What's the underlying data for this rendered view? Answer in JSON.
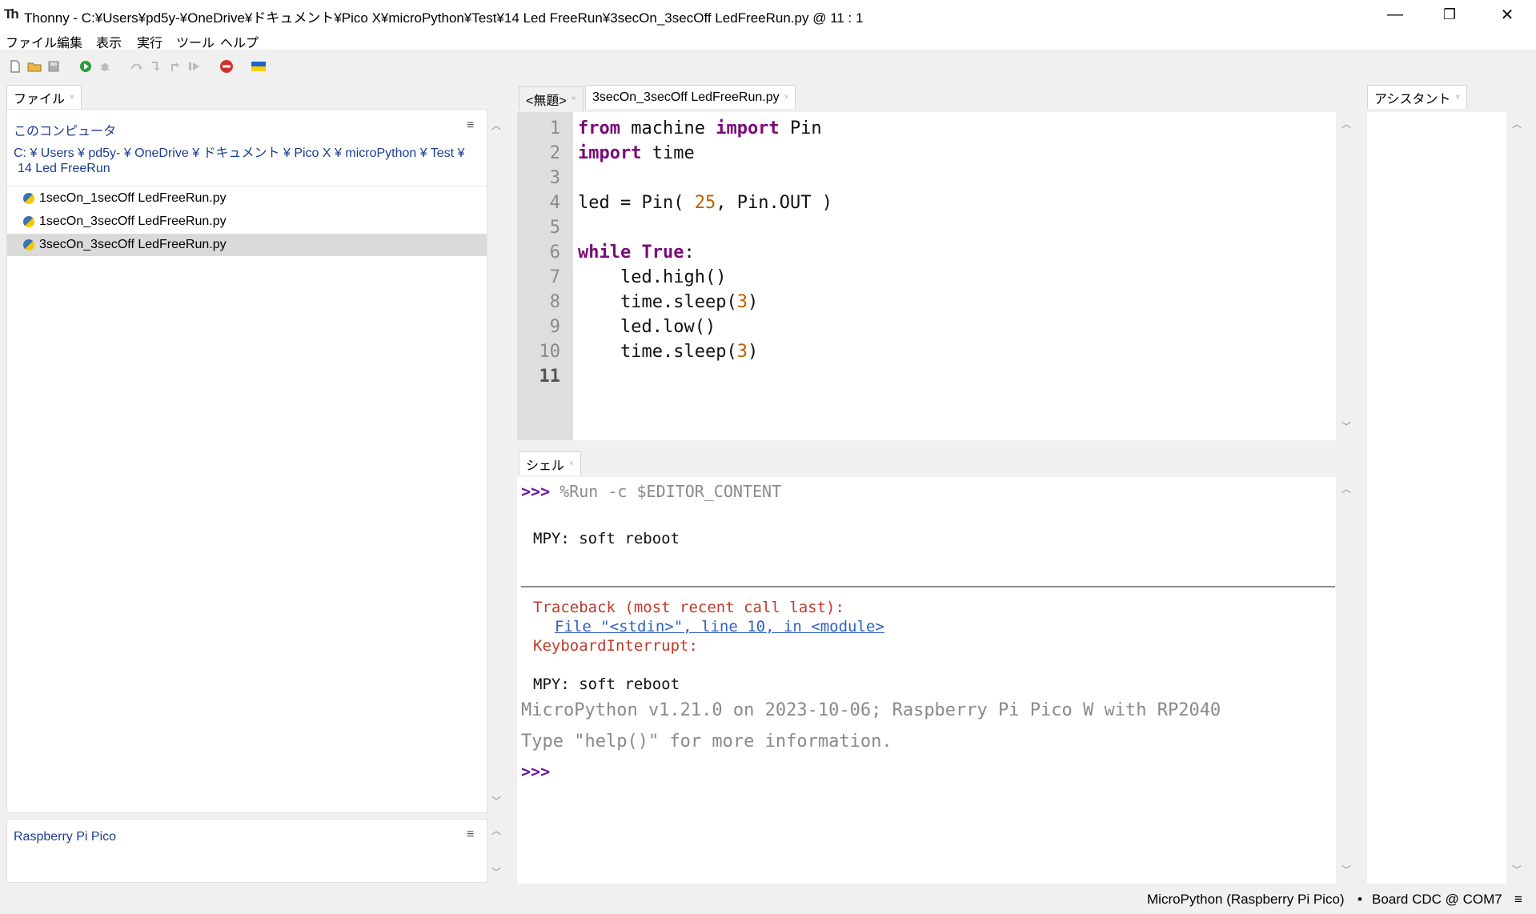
{
  "window": {
    "app_logo": "Th",
    "title": "Thonny  -  C:¥Users¥pd5y-¥OneDrive¥ドキュメント¥Pico X¥microPython¥Test¥14 Led FreeRun¥3secOn_3secOff LedFreeRun.py  @  11 : 1",
    "minimize_icon": "—",
    "restore_icon": "❐",
    "close_icon": "✕"
  },
  "menu": [
    "ファイル",
    "編集",
    "表示",
    "実行",
    "ツール",
    "ヘルプ"
  ],
  "toolbar": {
    "icons": [
      "new-file-icon",
      "open-file-icon",
      "save-icon",
      "run-icon",
      "debug-icon",
      "step-over-icon",
      "step-into-icon",
      "step-out-icon",
      "resume-icon",
      "stop-icon",
      "ukraine-flag-icon"
    ]
  },
  "files": {
    "tab": "ファイル",
    "close": "×",
    "section_title": "このコンピュータ",
    "menu_icon": "≡",
    "path_line1": "C: ¥ Users ¥ pd5y- ¥ OneDrive ¥ ドキュメント ¥ Pico X ¥ microPython ¥ Test ¥",
    "path_line2": "14 Led FreeRun",
    "items": [
      "1secOn_1secOff LedFreeRun.py",
      "1secOn_3secOff LedFreeRun.py",
      "3secOn_3secOff LedFreeRun.py"
    ],
    "selected_index": 2,
    "device_title": "Raspberry Pi Pico",
    "device_menu_icon": "≡"
  },
  "editor": {
    "tabs": [
      {
        "label": "<無題>",
        "close": "×"
      },
      {
        "label": "3secOn_3secOff LedFreeRun.py",
        "close": "×"
      }
    ],
    "active_tab": 1,
    "line_numbers": [
      "1",
      "2",
      "3",
      "4",
      "5",
      "6",
      "7",
      "8",
      "9",
      "10",
      "11"
    ],
    "lines": [
      "from machine import Pin",
      "import time",
      "",
      "led = Pin( 25, Pin.OUT )",
      "",
      "while True:",
      "    led.high()",
      "    time.sleep(3)",
      "    led.low()",
      "    time.sleep(3)",
      ""
    ]
  },
  "shell": {
    "tab": "シェル",
    "close": "×",
    "prompt": ">>>",
    "command": " %Run -c $EDITOR_CONTENT",
    "soft_reboot_1": "MPY: soft reboot",
    "traceback": "Traceback (most recent call last):",
    "file_link": "File \"<stdin>\", line 10, in <module>",
    "error": "KeyboardInterrupt:",
    "soft_reboot_2": "MPY: soft reboot",
    "banner": "MicroPython v1.21.0 on 2023-10-06; Raspberry Pi Pico W with RP2040",
    "help_hint": "Type \"help()\" for more information.",
    "final_prompt": ">>>"
  },
  "assistant": {
    "tab": "アシスタント",
    "close": "×"
  },
  "status": {
    "interpreter": "MicroPython (Raspberry Pi Pico)",
    "separator": "•",
    "port": "Board CDC @ COM7",
    "menu_icon": "≡"
  }
}
